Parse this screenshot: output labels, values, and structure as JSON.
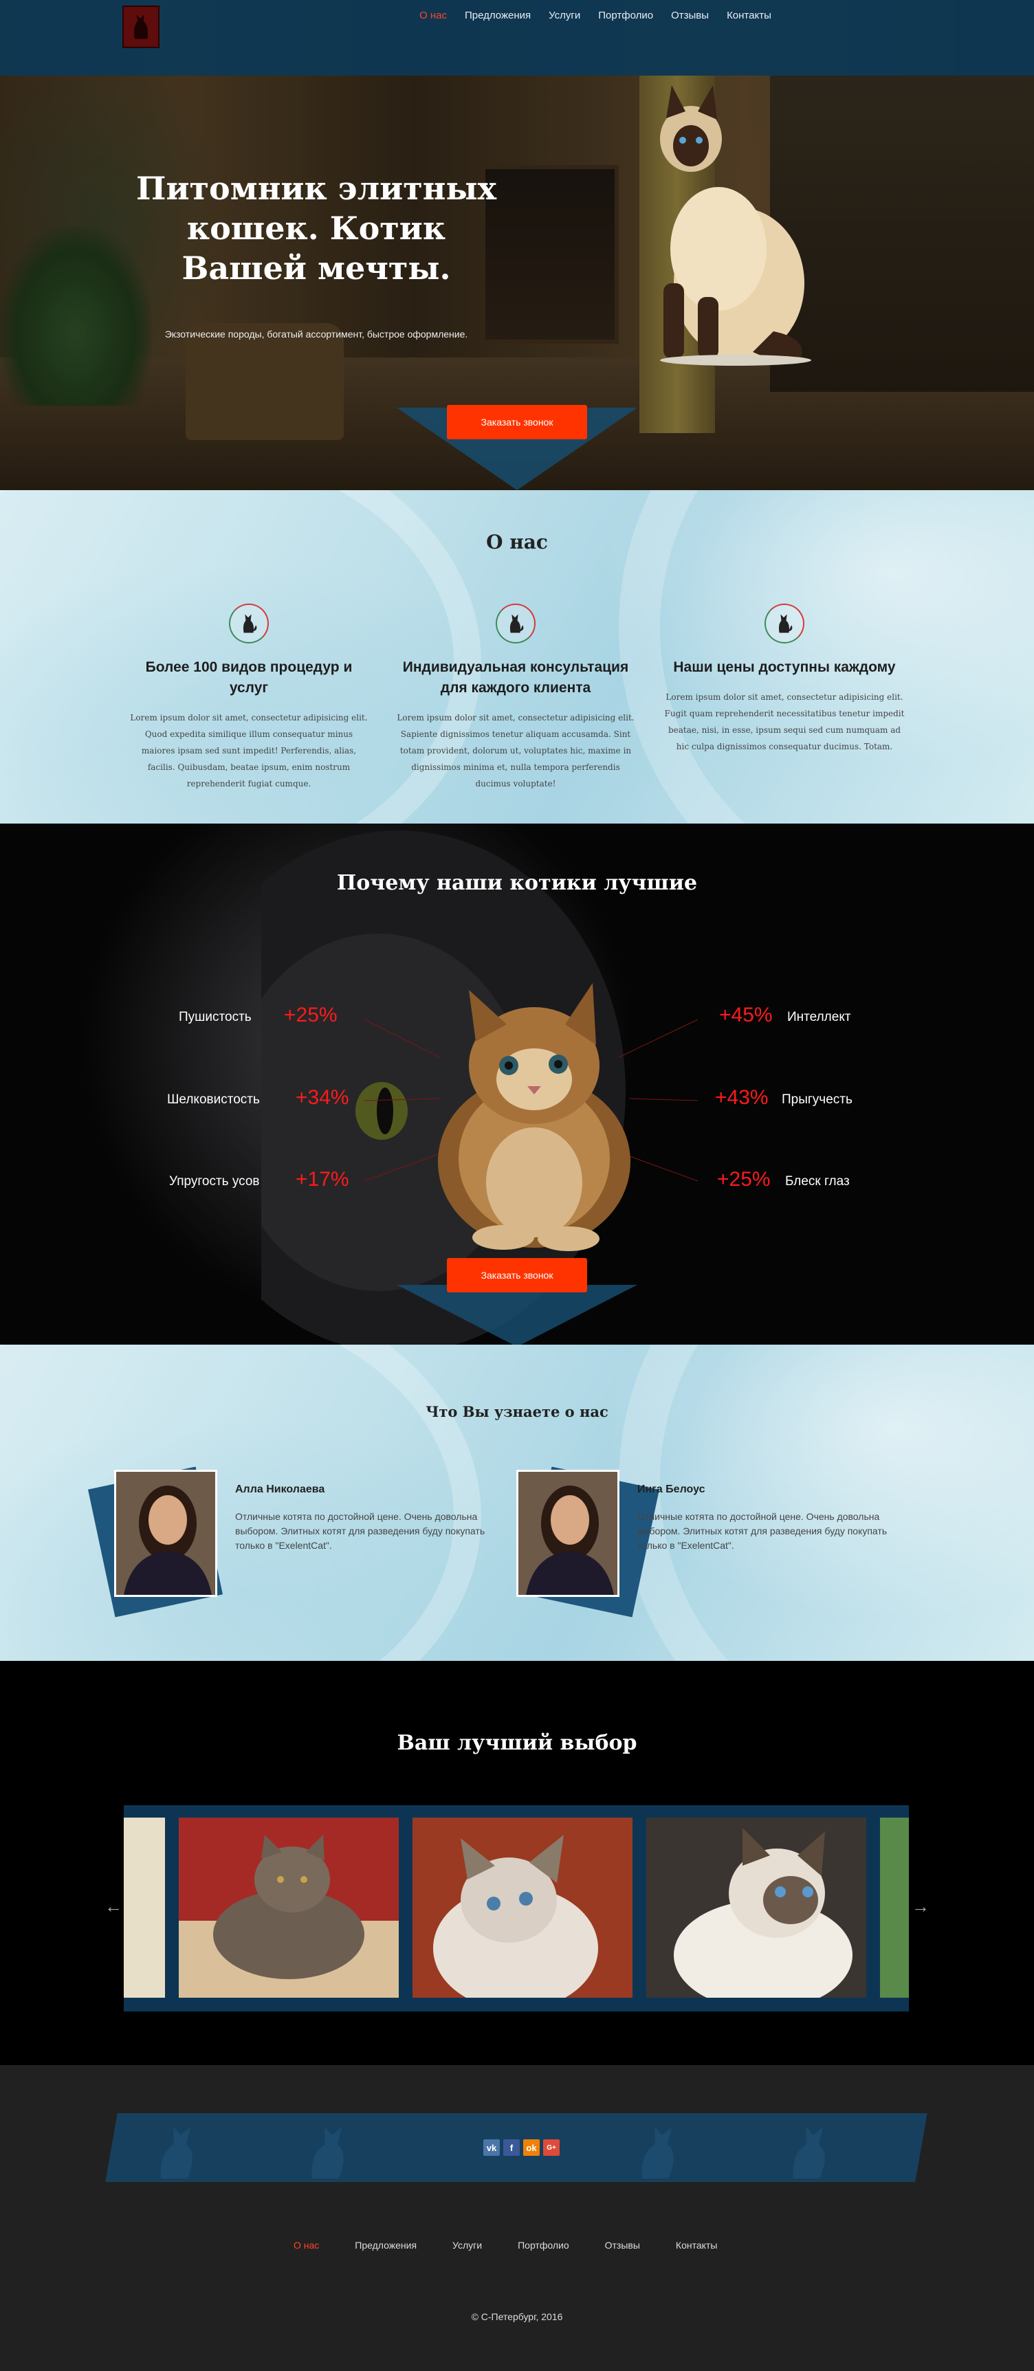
{
  "nav": {
    "items": [
      "О нас",
      "Предложения",
      "Услуги",
      "Портфолио",
      "Отзывы",
      "Контакты"
    ],
    "active_color": "#ff4526"
  },
  "hero": {
    "title": "Питомник элитных кошек. Котик Вашей мечты.",
    "subtitle": "Экзотические породы, богатый ассортимент, быстрое оформление.",
    "cta": "Заказать звонок"
  },
  "about": {
    "title": "О нас",
    "features": [
      {
        "icon": "cat-icon",
        "title": "Более 100 видов процедур и услуг",
        "text": "Lorem ipsum dolor sit amet, consectetur adipisicing elit. Quod expedita similique illum consequatur minus maiores ipsam sed sunt impedit! Perferendis, alias, facilis. Quibusdam, beatae ipsum, enim nostrum reprehenderit fugiat cumque."
      },
      {
        "icon": "cat-icon",
        "title": "Индивидуальная консультация для каждого клиента",
        "text": "Lorem ipsum dolor sit amet, consectetur adipisicing elit. Sapiente dignissimos tenetur aliquam accusamda. Sint totam provident, dolorum ut, voluptates hic, maxime in dignissimos minima et, nulla tempora perferendis ducimus voluptate!"
      },
      {
        "icon": "cat-icon",
        "title": "Наши цены доступны каждому",
        "text": "Lorem ipsum dolor sit amet, consectetur adipisicing elit. Fugit quam reprehenderit necessitatibus tenetur impedit beatae, nisi, in esse, ipsum sequi sed cum numquam ad hic culpa dignissimos consequatur ducimus. Totam."
      }
    ]
  },
  "why": {
    "title": "Почему наши котики лучшие",
    "stats_left": [
      {
        "label": "Пушистость",
        "value": "+25%"
      },
      {
        "label": "Шелковистость",
        "value": "+34%"
      },
      {
        "label": "Упругость усов",
        "value": "+17%"
      }
    ],
    "stats_right": [
      {
        "label": "Интеллект",
        "value": "+45%"
      },
      {
        "label": "Прыгучесть",
        "value": "+43%"
      },
      {
        "label": "Блеск глаз",
        "value": "+25%"
      }
    ],
    "cta": "Заказать звонок",
    "accent_color": "#ff1a1a"
  },
  "testimonials": {
    "title": "Что Вы узнаете о нас",
    "items": [
      {
        "name": "Алла Николаева",
        "text": "Отличные котята по достойной цене. Очень довольна выбором. Элитных котят для разведения буду покупать только в \"ExelentCat\"."
      },
      {
        "name": "Инга Белоус",
        "text": "Отличные котята по достойной цене. Очень довольна выбором. Элитных котят для разведения буду покупать только в \"ExelentCat\"."
      }
    ]
  },
  "best": {
    "title": "Ваш лучший выбор",
    "prev": "←",
    "next": "→"
  },
  "footer": {
    "social": [
      {
        "icon": "vk-icon",
        "label": "vk",
        "color": "#4a76a8"
      },
      {
        "icon": "facebook-icon",
        "label": "f",
        "color": "#3b5998"
      },
      {
        "icon": "odnoklassniki-icon",
        "label": "ok",
        "color": "#ee8208"
      },
      {
        "icon": "google-plus-icon",
        "label": "G+",
        "color": "#dd4b39"
      }
    ],
    "menu": [
      "О нас",
      "Предложения",
      "Услуги",
      "Портфолио",
      "Отзывы",
      "Контакты"
    ],
    "copyright": "© С-Петербург, 2016"
  },
  "colors": {
    "accent": "#ff3300",
    "brand_blue": "#164c6e"
  }
}
